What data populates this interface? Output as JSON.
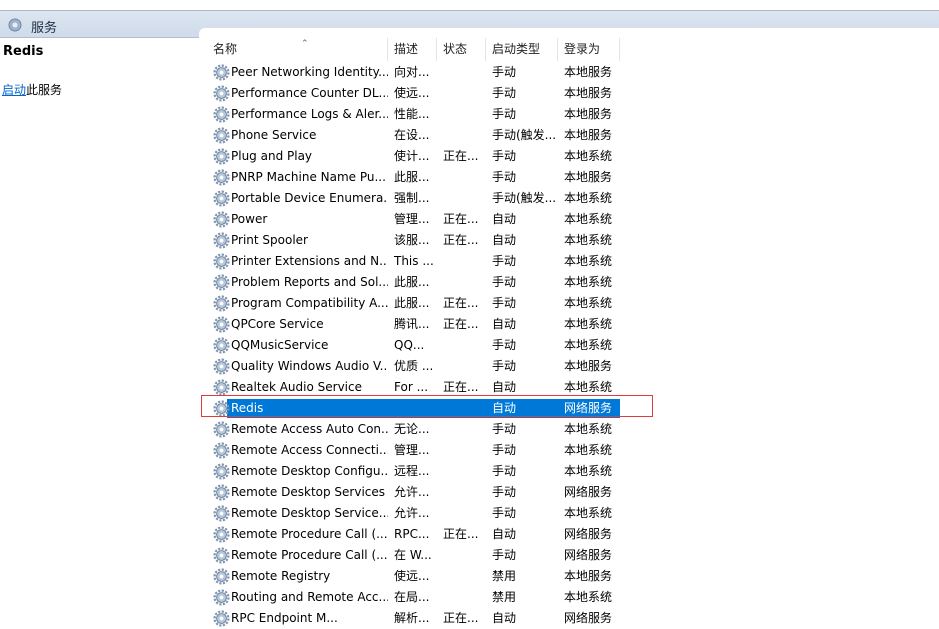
{
  "window": {
    "title": "服务"
  },
  "details": {
    "service_name": "Redis",
    "action_link": "启动",
    "action_suffix": "此服务"
  },
  "columns": {
    "name": "名称",
    "description": "描述",
    "status": "状态",
    "startup": "启动类型",
    "logon": "登录为"
  },
  "selected_index": 16,
  "services": [
    {
      "name": "Peer Networking Identity...",
      "desc": "向对...",
      "status": "",
      "startup": "手动",
      "logon": "本地服务"
    },
    {
      "name": "Performance Counter DL...",
      "desc": "使远...",
      "status": "",
      "startup": "手动",
      "logon": "本地服务"
    },
    {
      "name": "Performance Logs & Aler...",
      "desc": "性能...",
      "status": "",
      "startup": "手动",
      "logon": "本地服务"
    },
    {
      "name": "Phone Service",
      "desc": "在设...",
      "status": "",
      "startup": "手动(触发...",
      "logon": "本地服务"
    },
    {
      "name": "Plug and Play",
      "desc": "使计...",
      "status": "正在...",
      "startup": "手动",
      "logon": "本地系统"
    },
    {
      "name": "PNRP Machine Name Pu...",
      "desc": "此服...",
      "status": "",
      "startup": "手动",
      "logon": "本地服务"
    },
    {
      "name": "Portable Device Enumera...",
      "desc": "强制...",
      "status": "",
      "startup": "手动(触发...",
      "logon": "本地系统"
    },
    {
      "name": "Power",
      "desc": "管理...",
      "status": "正在...",
      "startup": "自动",
      "logon": "本地系统"
    },
    {
      "name": "Print Spooler",
      "desc": "该服...",
      "status": "正在...",
      "startup": "自动",
      "logon": "本地系统"
    },
    {
      "name": "Printer Extensions and N...",
      "desc": "This ...",
      "status": "",
      "startup": "手动",
      "logon": "本地系统"
    },
    {
      "name": "Problem Reports and Sol...",
      "desc": "此服...",
      "status": "",
      "startup": "手动",
      "logon": "本地系统"
    },
    {
      "name": "Program Compatibility A...",
      "desc": "此服...",
      "status": "正在...",
      "startup": "手动",
      "logon": "本地系统"
    },
    {
      "name": "QPCore Service",
      "desc": "腾讯...",
      "status": "正在...",
      "startup": "自动",
      "logon": "本地系统"
    },
    {
      "name": "QQMusicService",
      "desc": "QQ...",
      "status": "",
      "startup": "手动",
      "logon": "本地系统"
    },
    {
      "name": "Quality Windows Audio V...",
      "desc": "优质 ...",
      "status": "",
      "startup": "手动",
      "logon": "本地服务"
    },
    {
      "name": "Realtek Audio Service",
      "desc": "For ...",
      "status": "正在...",
      "startup": "自动",
      "logon": "本地系统"
    },
    {
      "name": "Redis",
      "desc": "",
      "status": "",
      "startup": "自动",
      "logon": "网络服务"
    },
    {
      "name": "Remote Access Auto Con...",
      "desc": "无论...",
      "status": "",
      "startup": "手动",
      "logon": "本地系统"
    },
    {
      "name": "Remote Access Connecti...",
      "desc": "管理...",
      "status": "",
      "startup": "手动",
      "logon": "本地系统"
    },
    {
      "name": "Remote Desktop Configu...",
      "desc": "远程...",
      "status": "",
      "startup": "手动",
      "logon": "本地系统"
    },
    {
      "name": "Remote Desktop Services",
      "desc": "允许...",
      "status": "",
      "startup": "手动",
      "logon": "网络服务"
    },
    {
      "name": "Remote Desktop Service...",
      "desc": "允许...",
      "status": "",
      "startup": "手动",
      "logon": "本地系统"
    },
    {
      "name": "Remote Procedure Call (...",
      "desc": "RPC...",
      "status": "正在...",
      "startup": "自动",
      "logon": "网络服务"
    },
    {
      "name": "Remote Procedure Call (...",
      "desc": "在 W...",
      "status": "",
      "startup": "手动",
      "logon": "网络服务"
    },
    {
      "name": "Remote Registry",
      "desc": "使远...",
      "status": "",
      "startup": "禁用",
      "logon": "本地服务"
    },
    {
      "name": "Routing and Remote Acc...",
      "desc": "在局...",
      "status": "",
      "startup": "禁用",
      "logon": "本地系统"
    },
    {
      "name": "RPC Endpoint M...",
      "desc": "解析...",
      "status": "正在...",
      "startup": "自动",
      "logon": "网络服务"
    }
  ]
}
